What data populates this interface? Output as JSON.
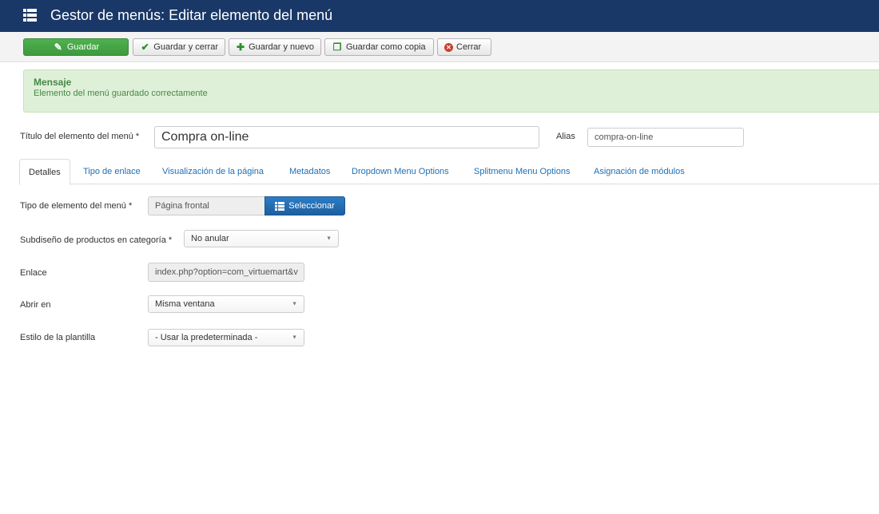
{
  "header": {
    "title": "Gestor de menús: Editar elemento del menú",
    "icon": "menu-list-icon"
  },
  "toolbar": {
    "save_label": "Guardar",
    "save_close_label": "Guardar y cerrar",
    "save_new_label": "Guardar y nuevo",
    "save_copy_label": "Guardar como copia",
    "close_label": "Cerrar"
  },
  "alert": {
    "heading": "Mensaje",
    "text": "Elemento del menú guardado correctamente"
  },
  "form": {
    "title_label": "Título del elemento del menú *",
    "title_value": "Compra on-line",
    "alias_label": "Alias",
    "alias_value": "compra-on-line"
  },
  "tabs": [
    {
      "label": "Detalles",
      "active": true
    },
    {
      "label": "Tipo de enlace"
    },
    {
      "label": "Visualización de la página"
    },
    {
      "label": "Metadatos"
    },
    {
      "label": "Dropdown Menu Options"
    },
    {
      "label": "Splitmenu Menu Options"
    },
    {
      "label": "Asignación de módulos"
    }
  ],
  "details": {
    "menu_type_label": "Tipo de elemento del menú *",
    "menu_type_value": "Página frontal",
    "select_button": "Seleccionar",
    "subdesign_label": "Subdiseño de productos en categoría *",
    "subdesign_value": "No anular",
    "link_label": "Enlace",
    "link_value": "index.php?option=com_virtuemart&v",
    "open_in_label": "Abrir en",
    "open_in_value": "Misma ventana",
    "template_style_label": "Estilo de la plantilla",
    "template_style_value": "- Usar la predeterminada -"
  },
  "colors": {
    "header_bg": "#1a3867",
    "save_green": "#46a546",
    "link_blue": "#1f6fb5",
    "alert_bg": "#dff0d8"
  }
}
